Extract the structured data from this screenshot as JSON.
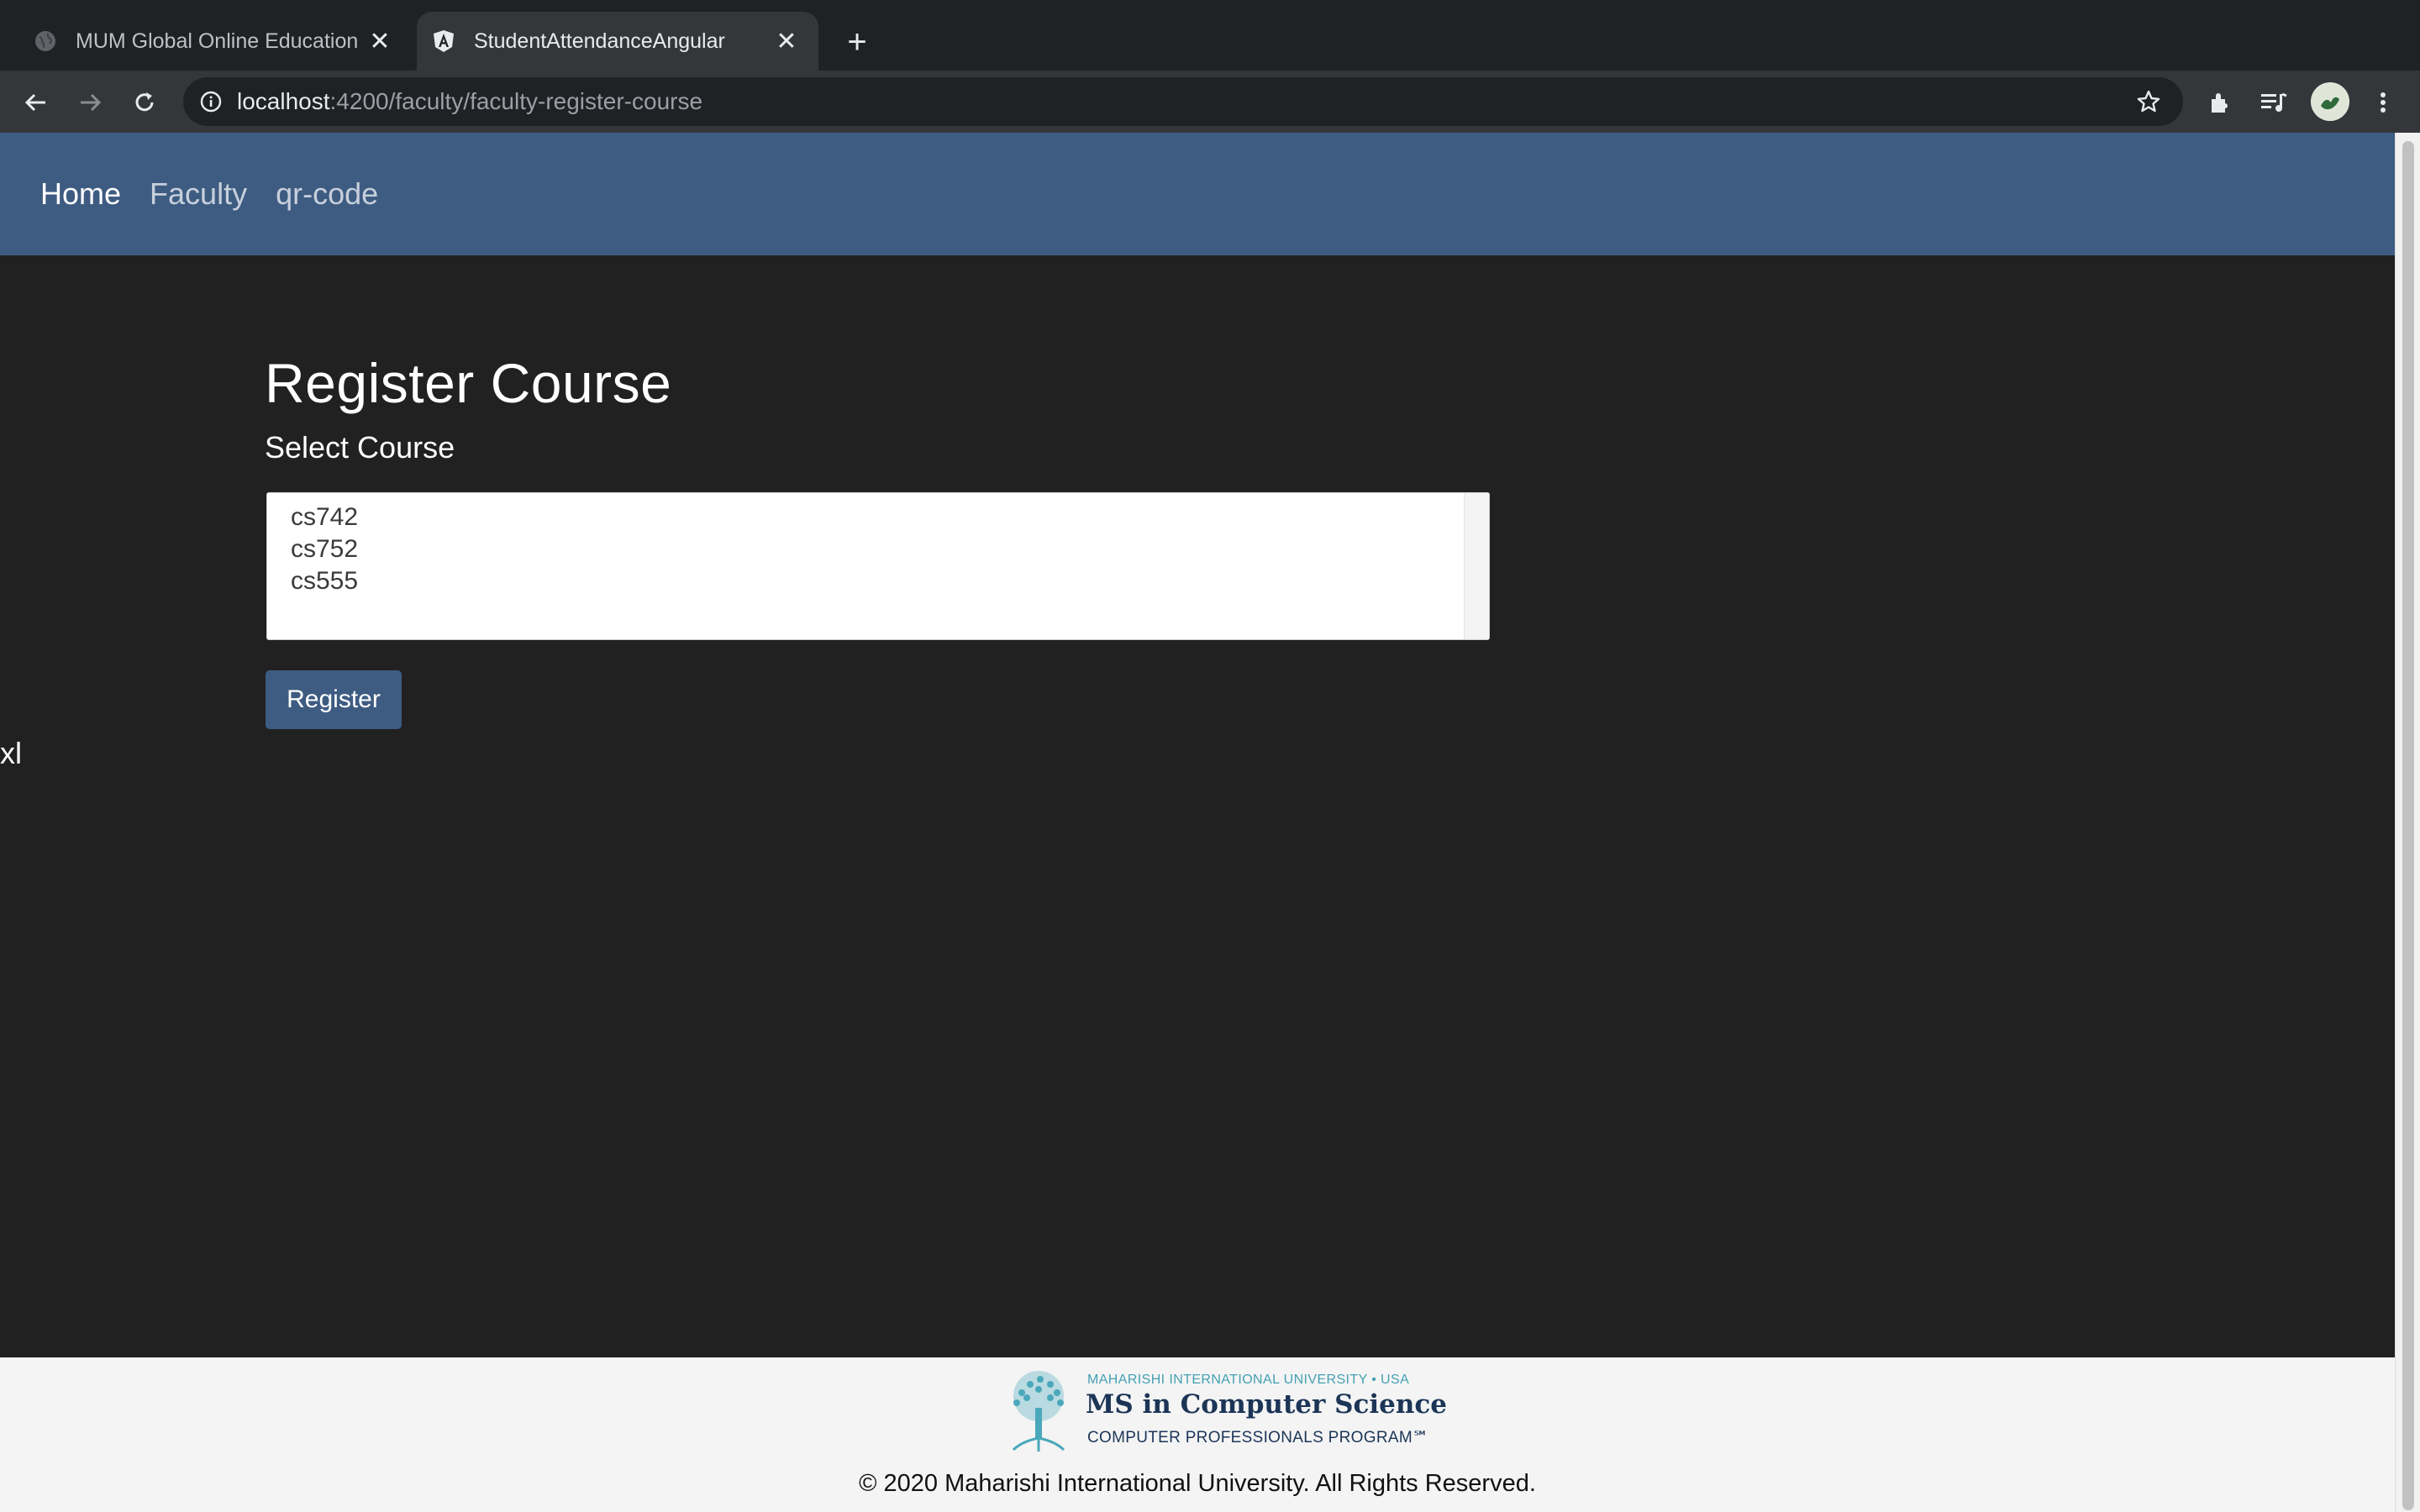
{
  "browser": {
    "tabs": [
      {
        "title": "MUM Global Online Education",
        "close": "✕",
        "favicon": "globe-icon"
      },
      {
        "title": "StudentAttendanceAngular",
        "close": "✕",
        "favicon": "angular-icon"
      }
    ],
    "new_tab": "+",
    "url_host": "localhost",
    "url_path": ":4200/faculty/faculty-register-course"
  },
  "navbar": {
    "links": [
      "Home",
      "Faculty",
      "qr-code"
    ],
    "active": "Home",
    "color": "#3e5c82"
  },
  "page": {
    "title": "Register Course",
    "select_label": "Select Course",
    "options": [
      "cs742",
      "cs752",
      "cs555"
    ],
    "register_label": "Register",
    "stray_text": "xl"
  },
  "footer": {
    "logo_small": "MAHARISHI INTERNATIONAL UNIVERSITY • USA",
    "logo_big": "MS in Computer Science",
    "logo_sub": "COMPUTER PROFESSIONALS PROGRAM℠",
    "copyright": "© 2020 Maharishi International University. All Rights Reserved."
  }
}
